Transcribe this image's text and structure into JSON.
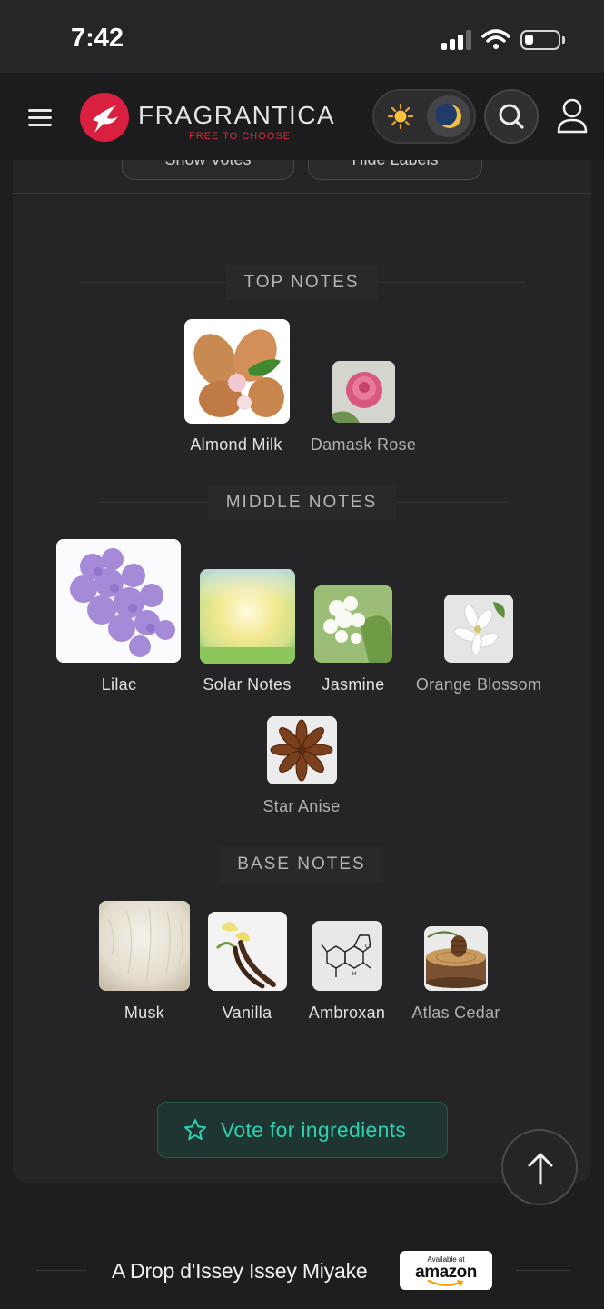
{
  "status_bar": {
    "time": "7:42"
  },
  "header": {
    "brand": "FRAGRANTICA",
    "tagline": "FREE TO CHOOSE",
    "colors": {
      "brand_red": "#d9203f",
      "accent_teal": "#2fd0b0"
    }
  },
  "top_controls": {
    "show_votes": "Show Votes",
    "hide_labels": "Hide Labels"
  },
  "pyramid": {
    "top_notes": {
      "title": "TOP NOTES",
      "notes": [
        {
          "label": "Almond Milk"
        },
        {
          "label": "Damask Rose"
        }
      ]
    },
    "middle_notes": {
      "title": "MIDDLE NOTES",
      "notes": [
        {
          "label": "Lilac"
        },
        {
          "label": "Solar Notes"
        },
        {
          "label": "Jasmine"
        },
        {
          "label": "Orange Blossom"
        },
        {
          "label": "Star Anise"
        }
      ]
    },
    "base_notes": {
      "title": "BASE NOTES",
      "notes": [
        {
          "label": "Musk"
        },
        {
          "label": "Vanilla"
        },
        {
          "label": "Ambroxan"
        },
        {
          "label": "Atlas Cedar"
        }
      ]
    }
  },
  "vote_button": {
    "label": "Vote for ingredients",
    "icon": "star-outline-icon"
  },
  "product_bar": {
    "name": "A Drop d'Issey Issey Miyake",
    "amazon_small": "Available at",
    "amazon_word": "amazon"
  }
}
